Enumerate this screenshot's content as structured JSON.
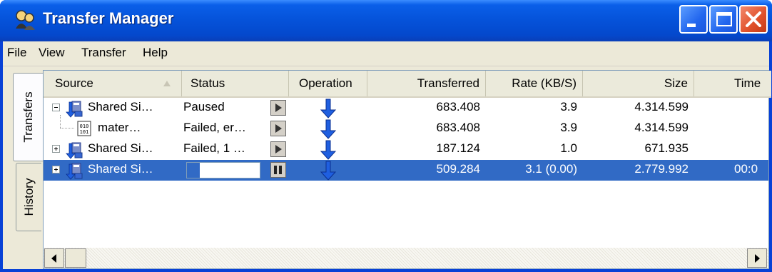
{
  "window": {
    "title": "Transfer Manager"
  },
  "menu": [
    "File",
    "View",
    "Transfer",
    "Help"
  ],
  "tabs": [
    "Transfers",
    "History"
  ],
  "columns": [
    "Source",
    "Status",
    "Operation",
    "Transferred",
    "Rate (KB/S)",
    "Size",
    "Time"
  ],
  "rows": [
    {
      "source": "Shared Si…",
      "status": "Paused",
      "transferred": "683.408",
      "rate": "3.9",
      "size": "4.314.599",
      "time": "",
      "expander": "minus",
      "icon": "site-icon",
      "action": "play"
    },
    {
      "source": "mater…",
      "status": "Failed, er…",
      "transferred": "683.408",
      "rate": "3.9",
      "size": "4.314.599",
      "time": "",
      "expander": "none",
      "icon": "file-icon",
      "action": "play"
    },
    {
      "source": "Shared Si…",
      "status": "Failed, 1 …",
      "transferred": "187.124",
      "rate": "1.0",
      "size": "671.935",
      "time": "",
      "expander": "plus",
      "icon": "site-icon",
      "action": "play"
    },
    {
      "source": "Shared Si…",
      "status": "18%",
      "progress": 0.18,
      "transferred": "509.284",
      "rate": "3.1 (0.00)",
      "size": "2.779.992",
      "time": "00:0",
      "expander": "plus",
      "icon": "site-icon",
      "action": "pause",
      "selected": true
    }
  ],
  "colors": {
    "titlebar": "#0552d9",
    "selection": "#316ac5",
    "operation_arrow": "#1f5fe0"
  }
}
